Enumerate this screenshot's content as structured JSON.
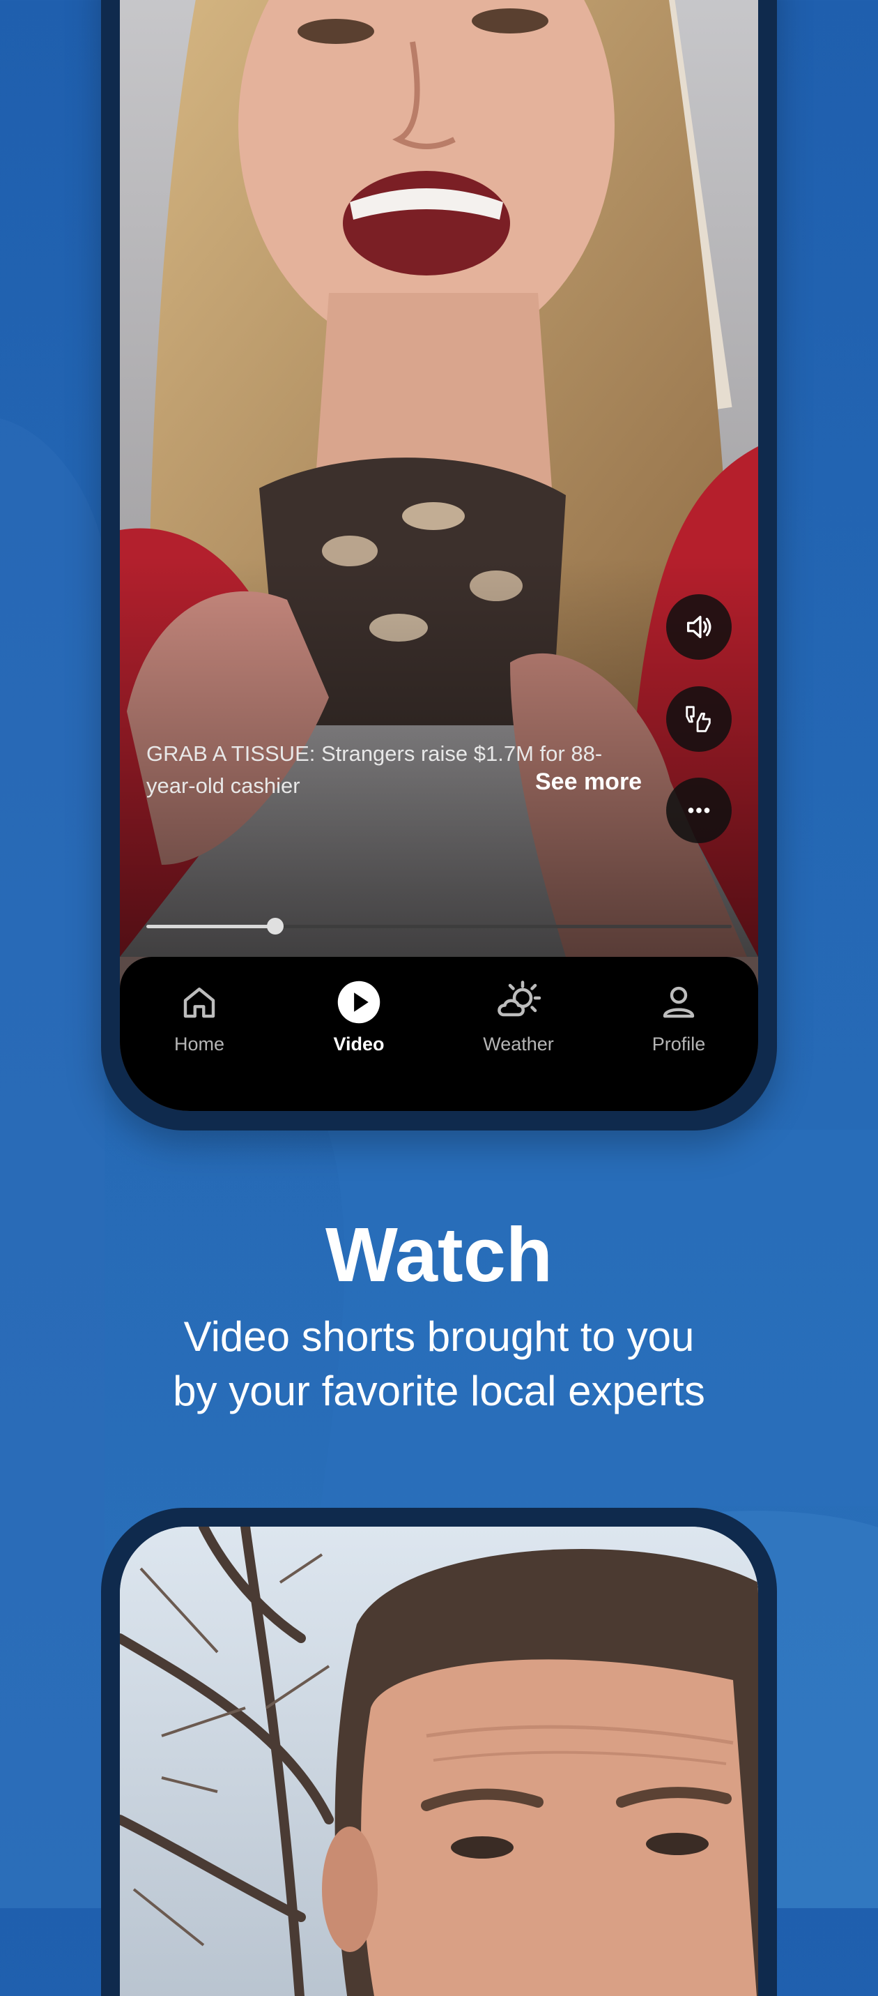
{
  "video": {
    "caption": "GRAB A TISSUE: Strangers raise $1.7M for 88-year-old cashier",
    "see_more": "See more",
    "progress": 0.22
  },
  "side_actions": [
    {
      "name": "volume-icon"
    },
    {
      "name": "dislike-like-icon"
    },
    {
      "name": "more-options-icon"
    }
  ],
  "tabs": [
    {
      "label": "Home",
      "icon": "home-icon",
      "active": false
    },
    {
      "label": "Video",
      "icon": "play-icon",
      "active": true
    },
    {
      "label": "Weather",
      "icon": "weather-icon",
      "active": false
    },
    {
      "label": "Profile",
      "icon": "profile-icon",
      "active": false
    }
  ],
  "promo": {
    "headline": "Watch",
    "subline_1": "Video shorts brought to you",
    "subline_2": "by your favorite local experts"
  },
  "colors": {
    "background": "#2467b4",
    "phone_frame": "#0f2a4d",
    "tabbar": "#000000"
  }
}
